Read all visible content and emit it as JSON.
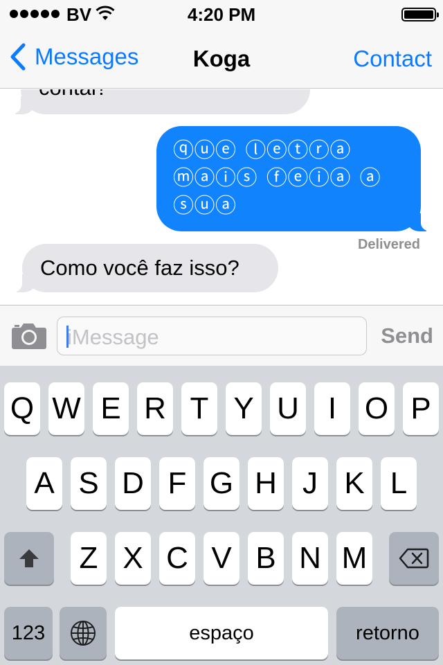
{
  "status_bar": {
    "carrier": "BV",
    "time": "4:20 PM"
  },
  "nav": {
    "back_label": "Messages",
    "title": "Koga",
    "contact_label": "Contact"
  },
  "messages": [
    {
      "direction": "received",
      "text": "contar!"
    },
    {
      "direction": "sent",
      "text": "ⓠⓤⓔ ⓛⓔⓣⓡⓐ ⓜⓐⓘⓢ ⓕⓔⓘⓐ ⓐ ⓢⓤⓐ",
      "status": "Delivered"
    },
    {
      "direction": "received",
      "text": "Como você faz isso?"
    }
  ],
  "input": {
    "placeholder": "iMessage",
    "send_label": "Send"
  },
  "keyboard": {
    "row1": [
      "Q",
      "W",
      "E",
      "R",
      "T",
      "Y",
      "U",
      "I",
      "O",
      "P"
    ],
    "row2": [
      "A",
      "S",
      "D",
      "F",
      "G",
      "H",
      "J",
      "K",
      "L"
    ],
    "row3": [
      "Z",
      "X",
      "C",
      "V",
      "B",
      "N",
      "M"
    ],
    "numbers_label": "123",
    "space_label": "espaço",
    "return_label": "retorno"
  },
  "icons": [
    "back-chevron-icon",
    "wifi-icon",
    "battery-icon",
    "camera-icon",
    "shift-icon",
    "backspace-icon",
    "globe-icon"
  ],
  "colors": {
    "accent": "#0a7afe",
    "sent_bubble": "#1184fd",
    "received_bubble": "#e5e5ea",
    "keyboard_bg": "#d4d7dc"
  }
}
